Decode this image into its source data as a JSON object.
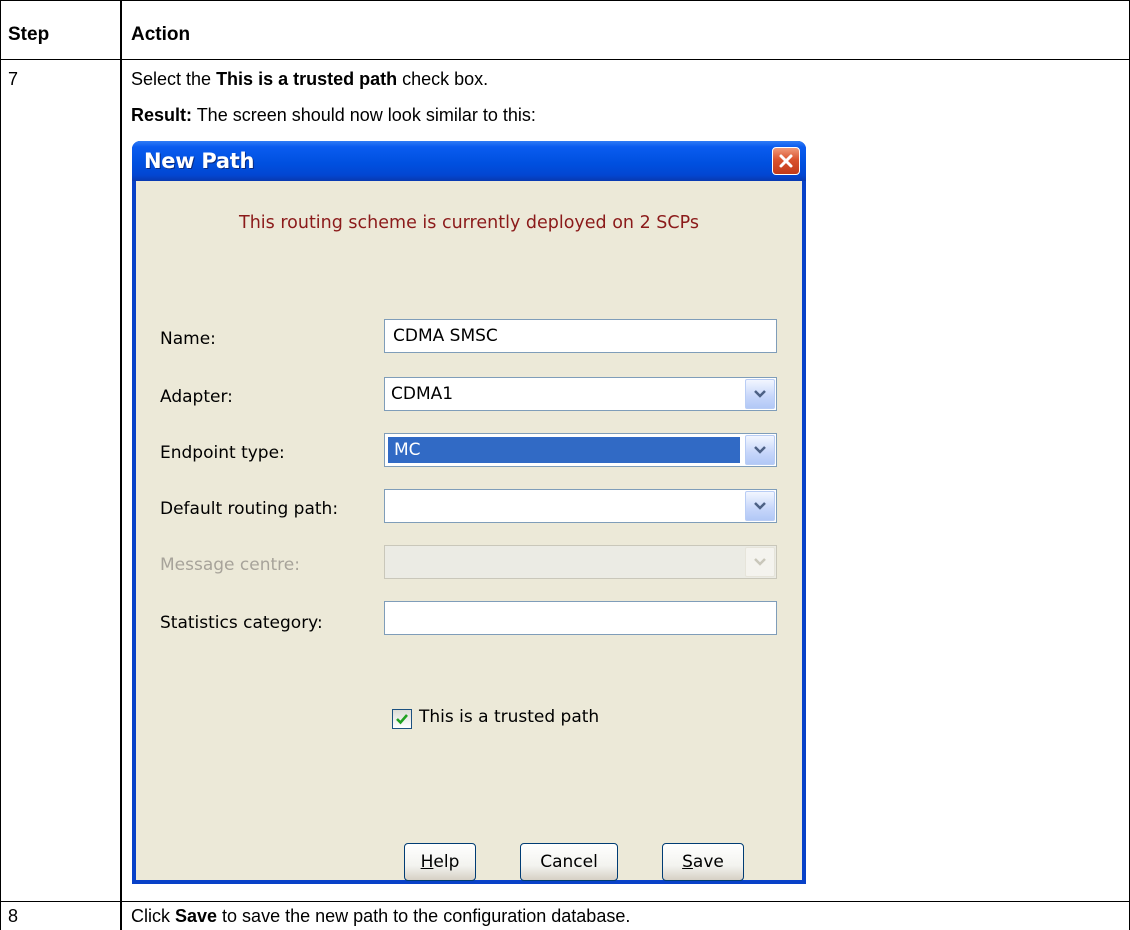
{
  "table": {
    "headers": {
      "step": "Step",
      "action": "Action"
    },
    "rows": [
      {
        "step": "7",
        "line1": {
          "pre": "Select the ",
          "bold": "This is a trusted path",
          "post": " check box."
        },
        "line2": {
          "bold": "Result:",
          "post": " The screen should now look similar to this:"
        }
      },
      {
        "step": "8",
        "line1": {
          "pre": "Click ",
          "bold": "Save",
          "post": " to save the new path to the configuration database."
        }
      }
    ]
  },
  "dialog": {
    "title": "New Path",
    "notice": "This routing scheme is currently deployed on 2 SCPs",
    "fields": {
      "name": {
        "label": "Name:",
        "value": "CDMA SMSC"
      },
      "adapter": {
        "label": "Adapter:",
        "value": "CDMA1"
      },
      "endpoint_type": {
        "label": "Endpoint type:",
        "value": "MC"
      },
      "default_routing_path": {
        "label": "Default routing path:",
        "value": ""
      },
      "message_centre": {
        "label": "Message centre:",
        "value": ""
      },
      "statistics_category": {
        "label": "Statistics category:",
        "value": ""
      }
    },
    "trusted": {
      "label": "This is a trusted path",
      "checked": true
    },
    "buttons": {
      "help": {
        "mnemonic": "H",
        "rest": "elp"
      },
      "cancel": {
        "label": "Cancel"
      },
      "save": {
        "mnemonic": "S",
        "rest": "ave"
      }
    },
    "icons": {
      "close": "close-icon",
      "dropdown": "chevron-down-icon",
      "check": "checkmark-icon"
    },
    "colors": {
      "title_bar": "#0050e0",
      "notice_text": "#8b1a1a",
      "selection": "#316ac5",
      "close_button": "#d9532e",
      "face": "#ece9d8"
    }
  }
}
